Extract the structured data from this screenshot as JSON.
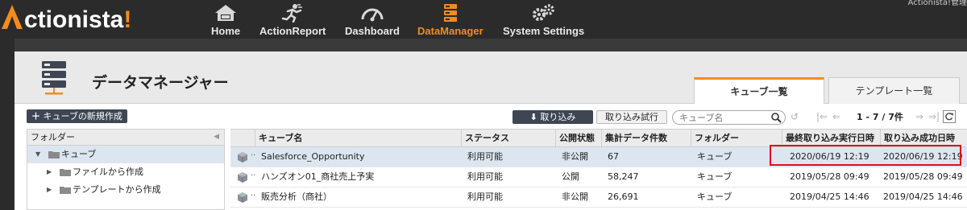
{
  "brand": {
    "name_first": "A",
    "name_rest": "ctionista",
    "name_bang": "!"
  },
  "user": {
    "label": "Actionista!管理"
  },
  "nav": [
    {
      "label": "Home",
      "icon": "home-icon"
    },
    {
      "label": "ActionReport",
      "icon": "runner-icon"
    },
    {
      "label": "Dashboard",
      "icon": "gauge-icon"
    },
    {
      "label": "DataManager",
      "icon": "database-icon"
    },
    {
      "label": "System Settings",
      "icon": "gears-icon"
    }
  ],
  "colors": {
    "accent": "#f28c1e",
    "topbar": "#2b2b2b",
    "button_dark": "#3d4652",
    "selection": "#dce6f0",
    "highlight_box": "#d9141b"
  },
  "page": {
    "title": "データマネージャー"
  },
  "tabs": {
    "cube_list": "キューブ一覧",
    "template_list": "テンプレート一覧"
  },
  "toolbar": {
    "new_cube": "キューブの新規作成",
    "import": "取り込み",
    "import_trial": "取り込み試行",
    "search_placeholder": "キューブ名",
    "pager": "1 - 7 / 7件"
  },
  "folder_panel": {
    "title": "フォルダー",
    "items": [
      {
        "label": "キューブ",
        "expanded": true,
        "selected": true
      },
      {
        "label": "ファイルから作成",
        "expanded": false,
        "selected": false
      },
      {
        "label": "テンプレートから作成",
        "expanded": false,
        "selected": false
      }
    ]
  },
  "grid": {
    "columns": [
      "キューブ名",
      "ステータス",
      "公開状態",
      "集計データ件数",
      "フォルダー",
      "最終取り込み実行日時",
      "取り込み成功日時"
    ],
    "rows": [
      {
        "name": "Salesforce_Opportunity",
        "status": "利用可能",
        "visibility": "非公開",
        "count": "67",
        "folder": "キューブ",
        "last_run": "2020/06/19 12:19",
        "last_success": "2020/06/19 12:19",
        "selected": true
      },
      {
        "name": "ハンズオン01_商社売上予実",
        "status": "利用可能",
        "visibility": "公開",
        "count": "58,247",
        "folder": "キューブ",
        "last_run": "2019/05/28 09:49",
        "last_success": "2019/05/28 09:49",
        "selected": false
      },
      {
        "name": "販売分析（商社）",
        "status": "利用可能",
        "visibility": "非公開",
        "count": "26,691",
        "folder": "キューブ",
        "last_run": "2019/04/25 14:46",
        "last_success": "2019/04/25 14:46",
        "selected": false
      }
    ]
  }
}
